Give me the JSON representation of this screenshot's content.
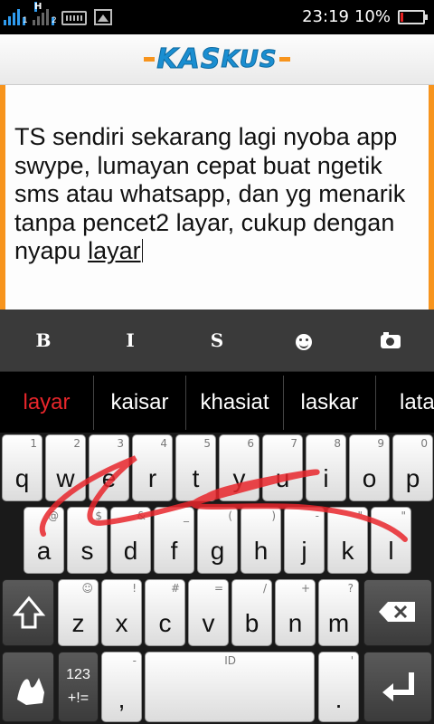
{
  "status": {
    "sim1": "1",
    "sim2": "2",
    "network": "H",
    "time": "23:19",
    "battery": "10%",
    "battery_level": 0.1,
    "battery_color": "#e32020"
  },
  "app": {
    "logo_left": "KAS",
    "logo_right": "KUS"
  },
  "editor": {
    "body": "TS sendiri sekarang lagi nyoba app swype, lumayan cepat buat ngetik sms atau whatsapp, dan yg menarik tanpa pencet2 layar, cukup dengan nyapu",
    "last_word": "layar"
  },
  "toolbar": {
    "bold": "B",
    "italic": "I",
    "strike": "S",
    "emoji_icon": "smiley-icon",
    "camera_icon": "camera-icon"
  },
  "suggestions": [
    "layar",
    "kaisar",
    "khasiat",
    "laskar",
    "lata"
  ],
  "keyboard": {
    "row1": [
      {
        "key": "q",
        "hint": "1"
      },
      {
        "key": "w",
        "hint": "2"
      },
      {
        "key": "e",
        "hint": "3"
      },
      {
        "key": "r",
        "hint": "4"
      },
      {
        "key": "t",
        "hint": "5"
      },
      {
        "key": "y",
        "hint": "6"
      },
      {
        "key": "u",
        "hint": "7"
      },
      {
        "key": "i",
        "hint": "8"
      },
      {
        "key": "o",
        "hint": "9"
      },
      {
        "key": "p",
        "hint": "0"
      }
    ],
    "row2": [
      {
        "key": "a",
        "hint": "@"
      },
      {
        "key": "s",
        "hint": "$"
      },
      {
        "key": "d",
        "hint": "&"
      },
      {
        "key": "f",
        "hint": "_"
      },
      {
        "key": "g",
        "hint": "("
      },
      {
        "key": "h",
        "hint": ")"
      },
      {
        "key": "j",
        "hint": "-"
      },
      {
        "key": "k",
        "hint": "\""
      },
      {
        "key": "l",
        "hint": "\""
      }
    ],
    "row3": [
      {
        "key": "z",
        "hint": "☺"
      },
      {
        "key": "x",
        "hint": "!"
      },
      {
        "key": "c",
        "hint": "#"
      },
      {
        "key": "v",
        "hint": "="
      },
      {
        "key": "b",
        "hint": "/"
      },
      {
        "key": "n",
        "hint": "+"
      },
      {
        "key": "m",
        "hint": "?"
      }
    ],
    "numsym": "123\n+!=",
    "comma": ",",
    "comma_hint": "-",
    "space_hint": "ID",
    "period": ".",
    "period_hint": "'",
    "swipe_color": "#e8262b"
  }
}
